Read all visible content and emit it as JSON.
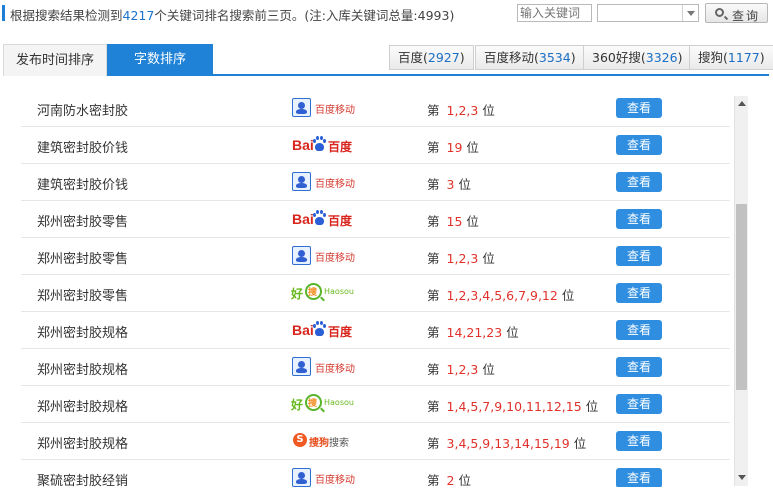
{
  "summary": {
    "prefix": "根据搜索结果检测到",
    "count": "4217",
    "suffix": "个关键词排名搜索前三页。(注:入库关键词总量:4993)"
  },
  "search": {
    "placeholder": "输入关键词",
    "value": "",
    "select_value": "",
    "button_label": "查询"
  },
  "tabs": [
    {
      "label": "发布时间排序",
      "active": false
    },
    {
      "label": "字数排序",
      "active": true
    }
  ],
  "engines": [
    {
      "name": "百度",
      "count": "2927"
    },
    {
      "name": "百度移动",
      "count": "3534"
    },
    {
      "name": "360好搜",
      "count": "3326"
    },
    {
      "name": "搜狗",
      "count": "1177"
    }
  ],
  "rank_prefix": "第",
  "rank_suffix": "位",
  "view_label": "查看",
  "logos": {
    "baidu_mobile": "百度移动",
    "baidu_a": "Bai",
    "baidu_b": "百度",
    "haosou_a": "好",
    "haosou_b": "Haosou",
    "sogou_icon": "S",
    "sogou_a": "搜狗",
    "sogou_b": "搜索"
  },
  "rows": [
    {
      "keyword": "河南防水密封胶",
      "engine": "baidu_mobile",
      "positions": "1,2,3"
    },
    {
      "keyword": "建筑密封胶价钱",
      "engine": "baidu",
      "positions": "19"
    },
    {
      "keyword": "建筑密封胶价钱",
      "engine": "baidu_mobile",
      "positions": "3"
    },
    {
      "keyword": "郑州密封胶零售",
      "engine": "baidu",
      "positions": "15"
    },
    {
      "keyword": "郑州密封胶零售",
      "engine": "baidu_mobile",
      "positions": "1,2,3"
    },
    {
      "keyword": "郑州密封胶零售",
      "engine": "haosou",
      "positions": "1,2,3,4,5,6,7,9,12"
    },
    {
      "keyword": "郑州密封胶规格",
      "engine": "baidu",
      "positions": "14,21,23"
    },
    {
      "keyword": "郑州密封胶规格",
      "engine": "baidu_mobile",
      "positions": "1,2,3"
    },
    {
      "keyword": "郑州密封胶规格",
      "engine": "haosou",
      "positions": "1,4,5,7,9,10,11,12,15"
    },
    {
      "keyword": "郑州密封胶规格",
      "engine": "sogou",
      "positions": "3,4,5,9,13,14,15,19"
    },
    {
      "keyword": "聚硫密封胶经销",
      "engine": "baidu_mobile",
      "positions": "2"
    }
  ]
}
